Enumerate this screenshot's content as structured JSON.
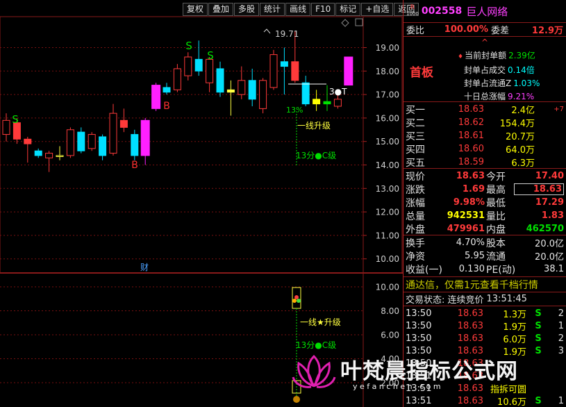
{
  "toolbar": [
    "复权",
    "叠加",
    "多股",
    "统计",
    "画线",
    "F10",
    "标记",
    "+自选",
    "返回"
  ],
  "stock": {
    "badge_top": "R",
    "badge_bottom": "1000",
    "code": "002558",
    "name": "巨人网络",
    "weibi_label": "委比",
    "weibi_value": "100.00%",
    "weicha_label": "委差",
    "weicha_value": "12.9万"
  },
  "limit": {
    "up_arrow": "^",
    "title": "首板",
    "rows": [
      {
        "label": "当前封单额",
        "value": "2.39亿",
        "color": "grn",
        "icon": "♦"
      },
      {
        "label": "封单占成交",
        "value": "0.14倍",
        "color": "cyan"
      },
      {
        "label": "封单占流通Z",
        "value": "1.03%",
        "color": "cyan"
      },
      {
        "label": "十日总涨幅",
        "value": "9.21%",
        "color": "mag"
      }
    ]
  },
  "buy": [
    {
      "label": "买一",
      "price": "18.63",
      "vol": "2.4亿",
      "extra": "+7"
    },
    {
      "label": "买二",
      "price": "18.62",
      "vol": "154.4万",
      "extra": ""
    },
    {
      "label": "买三",
      "price": "18.61",
      "vol": "20.7万",
      "extra": ""
    },
    {
      "label": "买四",
      "price": "18.60",
      "vol": "64.0万",
      "extra": ""
    },
    {
      "label": "买五",
      "price": "18.59",
      "vol": "6.3万",
      "extra": ""
    }
  ],
  "quote": [
    {
      "l1": "现价",
      "v1": "18.63",
      "c1": "red",
      "l2": "今开",
      "v2": "17.40",
      "c2": "red",
      "box": false
    },
    {
      "l1": "涨跌",
      "v1": "1.69",
      "c1": "red",
      "l2": "最高",
      "v2": "18.63",
      "c2": "red",
      "box": true
    },
    {
      "l1": "涨幅",
      "v1": "9.98%",
      "c1": "red",
      "l2": "最低",
      "v2": "17.29",
      "c2": "red",
      "box": false
    },
    {
      "l1": "总量",
      "v1": "942531",
      "c1": "yel",
      "l2": "量比",
      "v2": "1.83",
      "c2": "red",
      "box": false
    },
    {
      "l1": "外盘",
      "v1": "479961",
      "c1": "red",
      "l2": "内盘",
      "v2": "462570",
      "c2": "grn",
      "box": false
    }
  ],
  "fundamentals": [
    {
      "l1": "换手",
      "v1": "4.70%",
      "l2": "股本",
      "v2": "20.0亿"
    },
    {
      "l1": "净资",
      "v1": "5.95",
      "l2": "流通",
      "v2": "20.0亿"
    },
    {
      "l1": "收益(一)",
      "v1": "0.130",
      "l2": "PE(动)",
      "v2": "38.1"
    }
  ],
  "banner": "通达信，仅需1元查看千档行情",
  "trade_status": {
    "label": "交易状态: 连续竞价",
    "time": "13:51:45"
  },
  "ticks": [
    {
      "time": "13:50",
      "price": "18.63",
      "vol": "1.3万",
      "side": "S",
      "n": "2"
    },
    {
      "time": "13:50",
      "price": "18.63",
      "vol": "1.9万",
      "side": "S",
      "n": "1"
    },
    {
      "time": "13:50",
      "price": "18.63",
      "vol": "6.0万",
      "side": "S",
      "n": "2"
    },
    {
      "time": "13:50",
      "price": "18.63",
      "vol": "1.9万",
      "side": "S",
      "n": "3"
    },
    {
      "time": "13:50",
      "price": "18.63",
      "vol": "",
      "side": "",
      "n": ""
    },
    {
      "time": "13:51",
      "price": "18.63",
      "vol": "",
      "side": "",
      "n": ""
    },
    {
      "time": "13:51",
      "price": "18.63",
      "vol": "指拆可圆",
      "side": "",
      "n": ""
    },
    {
      "time": "13:51",
      "price": "18.63",
      "vol": "10.6万",
      "side": "S",
      "n": "1"
    }
  ],
  "chart": {
    "y_ticks": [
      "19.00",
      "18.00",
      "17.00",
      "16.00",
      "15.00",
      "14.00",
      "13.00",
      "12.00",
      "11.00",
      "10.00"
    ],
    "sub_ticks": [
      "10.00",
      "8.00",
      "6.00",
      "4.00",
      "2.00"
    ],
    "high_label": "19.71",
    "cai_label": "财",
    "sig_line": "一线升级",
    "sig_13": "13分●C级",
    "sig_pct": "13%",
    "sig_3t": "3●T",
    "sub_line": "一线★升级",
    "sub_13": "13分●C级",
    "b_markers": [
      "B",
      "B"
    ],
    "s_markers": [
      "S",
      "S",
      "S"
    ]
  },
  "watermark": {
    "title": "叶梵晨指标公式网",
    "url": "y e f a n c h e n . c o m"
  },
  "chart_data": {
    "type": "candlestick",
    "ylim": [
      10,
      19.71
    ],
    "candles": [
      {
        "o": 15.3,
        "c": 15.9,
        "h": 16.2,
        "l": 15.0
      },
      {
        "o": 15.8,
        "c": 15.1,
        "h": 16.0,
        "l": 14.9
      },
      {
        "o": 15.1,
        "c": 14.9,
        "h": 15.2,
        "l": 14.1
      },
      {
        "o": 14.6,
        "c": 14.4,
        "h": 14.7,
        "l": 14.3
      },
      {
        "o": 14.3,
        "c": 14.5,
        "h": 14.6,
        "l": 13.7
      },
      {
        "o": 14.4,
        "c": 14.4,
        "h": 14.8,
        "l": 14.2
      },
      {
        "o": 14.4,
        "c": 15.5,
        "h": 15.6,
        "l": 14.3
      },
      {
        "o": 15.4,
        "c": 14.6,
        "h": 15.6,
        "l": 14.5
      },
      {
        "o": 14.7,
        "c": 15.3,
        "h": 15.4,
        "l": 14.6
      },
      {
        "o": 15.2,
        "c": 14.4,
        "h": 15.3,
        "l": 14.2
      },
      {
        "o": 14.5,
        "c": 16.2,
        "h": 16.6,
        "l": 14.4
      },
      {
        "o": 15.9,
        "c": 15.6,
        "h": 16.4,
        "l": 15.4
      },
      {
        "o": 15.3,
        "c": 14.4,
        "h": 15.5,
        "l": 14.2
      },
      {
        "o": 14.4,
        "c": 15.9,
        "h": 16.0,
        "l": 14.0
      },
      {
        "o": 16.4,
        "c": 17.4,
        "h": 17.5,
        "l": 16.3
      },
      {
        "o": 17.1,
        "c": 17.3,
        "h": 17.5,
        "l": 17.0
      },
      {
        "o": 17.2,
        "c": 18.1,
        "h": 18.3,
        "l": 17.1
      },
      {
        "o": 17.8,
        "c": 18.6,
        "h": 18.8,
        "l": 17.6
      },
      {
        "o": 18.5,
        "c": 18.0,
        "h": 19.3,
        "l": 17.8
      },
      {
        "o": 17.5,
        "c": 18.5,
        "h": 18.6,
        "l": 17.1
      },
      {
        "o": 18.1,
        "c": 17.1,
        "h": 18.4,
        "l": 16.9
      },
      {
        "o": 17.2,
        "c": 17.1,
        "h": 17.6,
        "l": 16.1
      },
      {
        "o": 17.0,
        "c": 17.6,
        "h": 18.2,
        "l": 16.8
      },
      {
        "o": 17.6,
        "c": 16.8,
        "h": 18.1,
        "l": 16.5
      },
      {
        "o": 16.4,
        "c": 17.6,
        "h": 17.7,
        "l": 16.2
      },
      {
        "o": 17.3,
        "c": 18.7,
        "h": 18.9,
        "l": 17.2
      },
      {
        "o": 18.4,
        "c": 18.2,
        "h": 19.0,
        "l": 17.0
      },
      {
        "o": 18.4,
        "c": 17.6,
        "h": 19.7,
        "l": 17.5
      },
      {
        "o": 17.5,
        "c": 16.6,
        "h": 17.8,
        "l": 16.5
      },
      {
        "o": 16.8,
        "c": 16.6,
        "h": 17.2,
        "l": 16.3
      },
      {
        "o": 16.6,
        "c": 16.7,
        "h": 17.4,
        "l": 16.3
      },
      {
        "o": 16.5,
        "c": 16.8,
        "h": 17.0,
        "l": 16.4
      },
      {
        "o": 17.4,
        "c": 18.6,
        "h": 18.6,
        "l": 17.4
      }
    ]
  }
}
